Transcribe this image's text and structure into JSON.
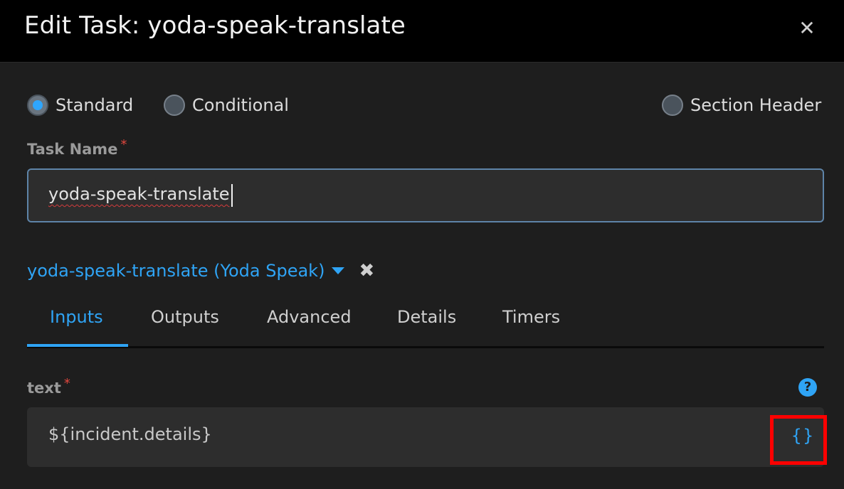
{
  "dialog": {
    "title": "Edit Task: yoda-speak-translate",
    "close_icon": "close-icon"
  },
  "task_type": {
    "options": [
      {
        "label": "Standard",
        "selected": true
      },
      {
        "label": "Conditional",
        "selected": false
      },
      {
        "label": "Section Header",
        "selected": false
      }
    ]
  },
  "task_name": {
    "label": "Task Name",
    "required_mark": "*",
    "value": "yoda-speak-translate"
  },
  "integration": {
    "label": "yoda-speak-translate (Yoda Speak)",
    "dropdown_icon": "caret-down-icon",
    "remove_icon": "remove-icon",
    "remove_glyph": "✖"
  },
  "tabs": [
    {
      "label": "Inputs",
      "active": true
    },
    {
      "label": "Outputs",
      "active": false
    },
    {
      "label": "Advanced",
      "active": false
    },
    {
      "label": "Details",
      "active": false
    },
    {
      "label": "Timers",
      "active": false
    }
  ],
  "inputs": {
    "text_field": {
      "label": "text",
      "required_mark": "*",
      "value": "${incident.details}",
      "help_glyph": "?",
      "editor_glyph": "{}"
    }
  },
  "colors": {
    "accent": "#2fa4f5",
    "required": "#e2473e",
    "highlight_box": "#ff0000",
    "header_bg": "#000000",
    "panel_bg": "#1e1e1e",
    "input_bg": "#2d2d2d"
  }
}
